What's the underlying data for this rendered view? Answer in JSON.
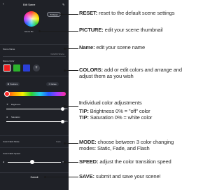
{
  "app": {
    "title": "Edit Scene",
    "reset_label": "Reset",
    "scene_picture_label": "Scene Pic",
    "scene_name_label": "Scene Name",
    "scene_name_value": "Colorful Scene",
    "scene_colors_label": "Scene Color",
    "add_color_label": "+",
    "positions_label": "Positions",
    "delete_label": "Delete",
    "brightness_label": "Brightness",
    "brightness_value": "99%",
    "saturation_label": "Saturation",
    "saturation_value": "99%",
    "color_flash_mode_label": "Color Flash Mode",
    "color_flash_mode_value": "Fade",
    "color_flash_speed_label": "Color Flash Speed",
    "submit_label": "Submit",
    "colors": [
      "#f01f1f",
      "#2db32d",
      "#2b3fd8"
    ],
    "brightness_fraction": 0.99,
    "saturation_fraction": 0.99,
    "speed_fraction": 0.45,
    "icons": [
      "back-arrow-icon",
      "edit-icon",
      "reset-icon",
      "plus-icon",
      "sun-icon",
      "droplet-icon",
      "turtle-icon",
      "rabbit-icon"
    ]
  },
  "callouts": {
    "reset_key": "RESET:",
    "reset_text": " reset to the default scene settings",
    "picture_key": "PICTURE:",
    "picture_text": " edit your scene thumbnail",
    "name_key": "Name:",
    "name_text": " edit your scene name",
    "colors_key": "COLORS:",
    "colors_text": " add or edit colors and arrange and adjust them as you wish",
    "individual_key": "I",
    "individual_text": "ndividual color adjustments",
    "tip1_key": "TIP:",
    "tip1_text": " Brightness 0% = \"off\" color",
    "tip2_key": "TIP:",
    "tip2_text": " Saturation 0% = white color",
    "mode_key": "MODE:",
    "mode_text": " choose between 3 color changing modes: Static, Fade, and Flash",
    "speed_key": "SPEED:",
    "speed_text": " adjust the color transition speed",
    "save_key": "SAVE:",
    "save_text": " submit and save your scene!"
  }
}
